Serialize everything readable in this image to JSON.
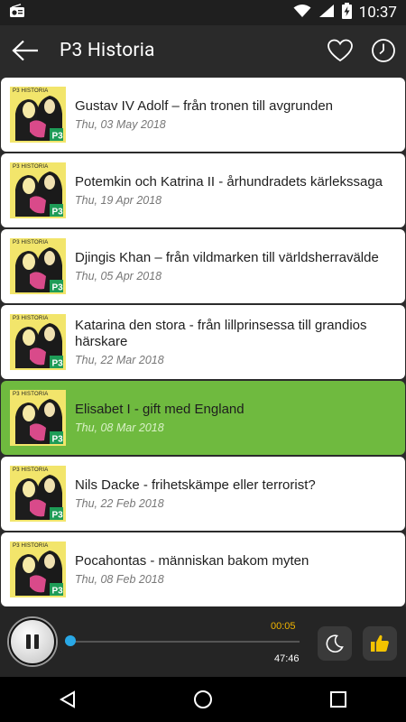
{
  "status_bar": {
    "time": "10:37"
  },
  "app_bar": {
    "title": "P3 Historia"
  },
  "episodes": [
    {
      "title": "Gustav IV Adolf –  från tronen till avgrunden",
      "date": "Thu, 03 May 2018",
      "thumb_label": "P3 HISTORIA"
    },
    {
      "title": "Potemkin och Katrina II - århundradets kärlekssaga",
      "date": "Thu, 19 Apr 2018",
      "thumb_label": "P3 HISTORIA"
    },
    {
      "title": "Djingis Khan –  från vildmarken till världsherravälde",
      "date": "Thu, 05 Apr 2018",
      "thumb_label": "P3 HISTORIA"
    },
    {
      "title": "Katarina den stora - från lillprinsessa till grandios härskare",
      "date": "Thu, 22 Mar 2018",
      "thumb_label": "P3 HISTORIA"
    },
    {
      "title": "Elisabet I - gift med England",
      "date": "Thu, 08 Mar 2018",
      "thumb_label": "P3 HISTORIA",
      "active": true
    },
    {
      "title": "Nils Dacke - frihetskämpe eller terrorist?",
      "date": "Thu, 22 Feb 2018",
      "thumb_label": "P3 HISTORIA"
    },
    {
      "title": "Pocahontas - människan bakom myten",
      "date": "Thu, 08 Feb 2018",
      "thumb_label": "P3 HISTORIA"
    }
  ],
  "player": {
    "current_time": "00:05",
    "total_time": "47:46",
    "progress": 0.002
  },
  "colors": {
    "active_item": "#6fba3f",
    "progress_knob": "#29a8e6",
    "current_time": "#f0b400",
    "thumb_bg": "#f2e56b",
    "like_icon": "#f3c300"
  },
  "icons": {
    "status_left": "radio-icon",
    "status_right": [
      "wifi-icon",
      "signal-icon",
      "battery-charging-icon"
    ],
    "app_bar": [
      "back-arrow-icon",
      "heart-icon",
      "clock-icon"
    ],
    "player": [
      "pause-icon",
      "moon-icon",
      "thumbs-up-icon"
    ],
    "navbar": [
      "back-triangle-icon",
      "home-circle-icon",
      "recents-square-icon"
    ]
  }
}
